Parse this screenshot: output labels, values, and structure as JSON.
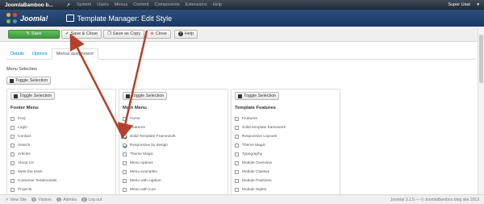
{
  "navbar": {
    "brand": "JoomlaBamboo b...",
    "menu": [
      "System",
      "Users",
      "Menus",
      "Content",
      "Components",
      "Extensions",
      "Help"
    ],
    "user": "Super User"
  },
  "header": {
    "logo": "Joomla!",
    "title": "Template Manager: Edit Style"
  },
  "toolbar": {
    "save": "Save",
    "save_close": "Save & Close",
    "save_copy": "Save as Copy",
    "close": "Close",
    "help": "Help"
  },
  "tabs": [
    "Details",
    "Options",
    "Menus assignment"
  ],
  "menu_selection": {
    "label": "Menu Selection",
    "toggle": "Toggle Selection"
  },
  "columns": [
    {
      "toggle": "Toggle Selection",
      "title": "Footer Menu",
      "items": [
        {
          "label": "FAQ",
          "checked": false
        },
        {
          "label": "Login",
          "checked": false
        },
        {
          "label": "Contact",
          "checked": false
        },
        {
          "label": "Search",
          "checked": false
        },
        {
          "label": "Articles",
          "checked": false
        },
        {
          "label": "About Us",
          "checked": false
        },
        {
          "label": "Meet the team",
          "checked": false
        },
        {
          "label": "Customer Testimonials",
          "checked": false
        },
        {
          "label": "Projects",
          "checked": false
        },
        {
          "label": "Project #1",
          "checked": false
        }
      ]
    },
    {
      "toggle": "Toggle Selection",
      "title": "Main Menu",
      "items": [
        {
          "label": "Home",
          "checked": false
        },
        {
          "label": "Features",
          "checked": false
        },
        {
          "label": "Solid Template Framework",
          "checked": true
        },
        {
          "label": "Responsive by design",
          "checked": true
        },
        {
          "label": "Theme Magic",
          "checked": false
        },
        {
          "label": "Menu options",
          "checked": false
        },
        {
          "label": "Menu examples",
          "checked": false
        },
        {
          "label": "Menu with caption",
          "checked": false
        },
        {
          "label": "Menu with icon",
          "checked": false
        },
        {
          "label": "Menu with module",
          "checked": false
        }
      ]
    },
    {
      "toggle": "Toggle Selection",
      "title": "Template Features",
      "items": [
        {
          "label": "Features",
          "checked": false
        },
        {
          "label": "Solid template framework",
          "checked": false
        },
        {
          "label": "Responsive Layouts",
          "checked": false
        },
        {
          "label": "Theme Magic",
          "checked": false
        },
        {
          "label": "Typography",
          "checked": false
        },
        {
          "label": "Module Overview",
          "checked": false
        },
        {
          "label": "Module Classes",
          "checked": false
        },
        {
          "label": "Module Positions",
          "checked": false
        },
        {
          "label": "Module Styles",
          "checked": false
        },
        {
          "label": "Tabs",
          "checked": false
        }
      ]
    }
  ],
  "statusbar": {
    "view_site": "View Site",
    "visitors_count": "0",
    "visitors": "Visitors",
    "admins_count": "1",
    "admins": "Admins",
    "logout_count": "0",
    "logout": "Log out",
    "footer": "Joomla! 3.1.5 — © JoomlaBamboo blog site 2013"
  },
  "colors": {
    "navbar": "#1f2a35",
    "header": "#1a3a63",
    "save_green": "#46a546",
    "arrow_red": "#b5402c"
  }
}
